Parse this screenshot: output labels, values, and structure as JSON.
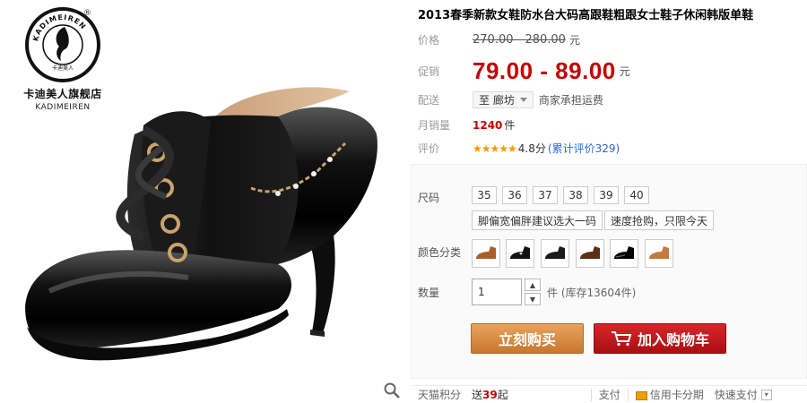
{
  "brand": {
    "reg_mark": "®",
    "name_cn": "卡迪美人旗舰店",
    "name_en": "KADIMEIREN",
    "ring_text": "KADIMEIREN",
    "ring_cn": "卡迪美人"
  },
  "product": {
    "title": "2013春季新款女鞋防水台大码高跟鞋粗跟女士鞋子休闲韩版单鞋"
  },
  "price": {
    "label": "价格",
    "original": "270.00 - 280.00",
    "unit": "元"
  },
  "promo": {
    "label": "促销",
    "value": "79.00 - 89.00",
    "unit": "元"
  },
  "shipping": {
    "label": "配送",
    "destination": "至 廊坊",
    "note": "商家承担运费"
  },
  "monthly_sales": {
    "label": "月销量",
    "value": "1240",
    "unit": "件"
  },
  "rating": {
    "label": "评价",
    "stars": "★★★★★",
    "score": "4.8分",
    "reviews_link": "(累计评价329)"
  },
  "size": {
    "label": "尺码",
    "options": [
      "35",
      "36",
      "37",
      "38",
      "39",
      "40"
    ],
    "tip1": "脚偏宽偏胖建议选大一码",
    "tip2": "速度抢购，只限今天"
  },
  "color": {
    "label": "颜色分类"
  },
  "quantity": {
    "label": "数量",
    "value": "1",
    "stock": "件 (库存13604件)"
  },
  "actions": {
    "buy_now": "立刻购买",
    "add_to_cart": "加入购物车"
  },
  "footer": {
    "points_label": "天猫积分",
    "points_prefix": "送",
    "points_value": "39",
    "points_suffix": "起",
    "pay_label": "支付",
    "card_pay": "信用卡分期",
    "quick_pay": "快速支付"
  },
  "colors": {
    "price_red": "#c40000",
    "buy_now_orange": "#d98c40",
    "cart_red": "#c0161a",
    "link_blue": "#3366cc",
    "star_orange": "#ff9900"
  }
}
